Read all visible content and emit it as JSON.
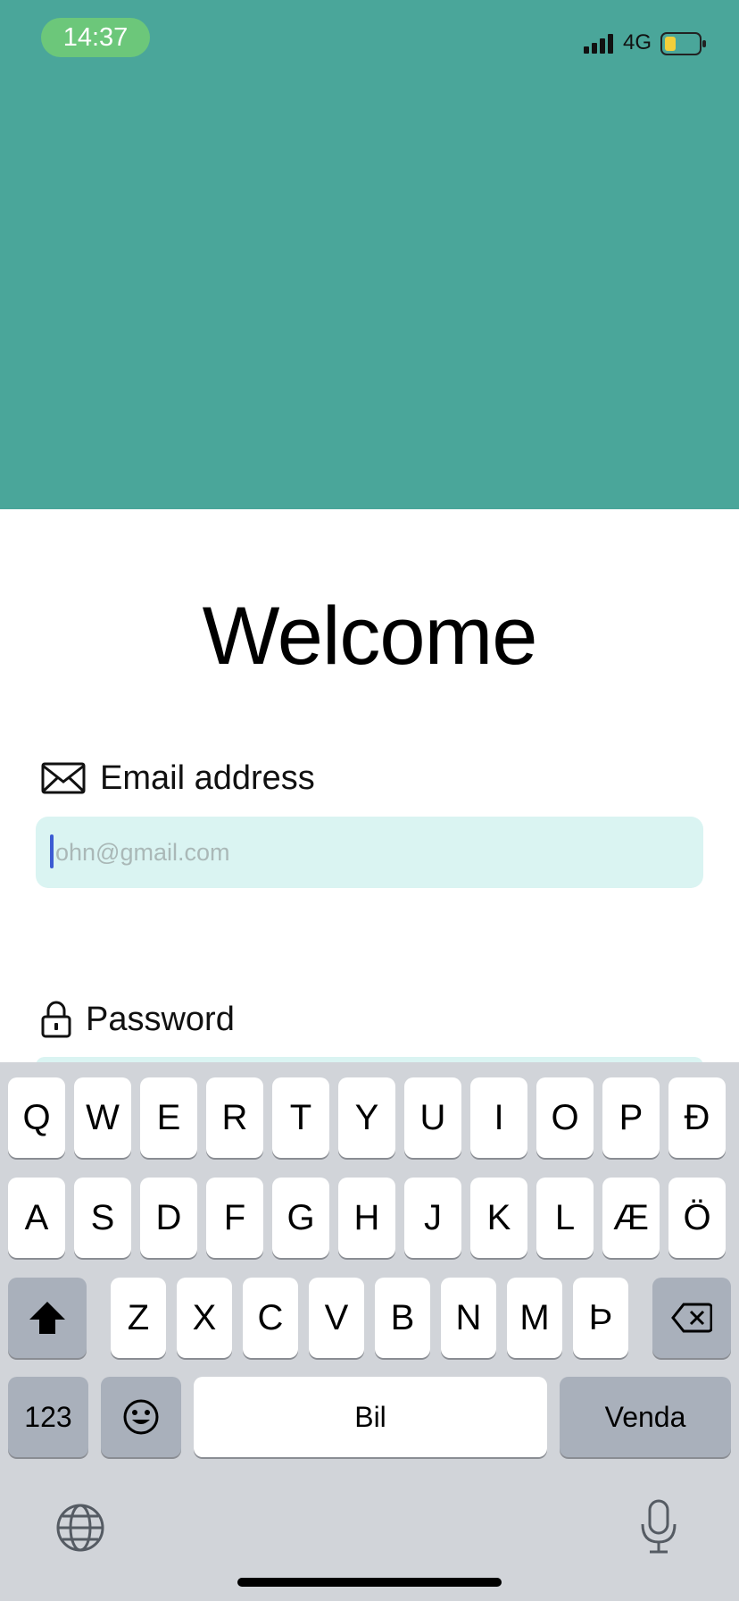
{
  "status_bar": {
    "time": "14:37",
    "network": "4G",
    "battery_color": "#f3cf3b"
  },
  "hero": {
    "color": "#4aa69a"
  },
  "login": {
    "title": "Welcome",
    "email_label": "Email address",
    "email_placeholder": "ohn@gmail.com",
    "password_label": "Password"
  },
  "keyboard": {
    "row1": [
      "Q",
      "W",
      "E",
      "R",
      "T",
      "Y",
      "U",
      "I",
      "O",
      "P",
      "Ð"
    ],
    "row2": [
      "A",
      "S",
      "D",
      "F",
      "G",
      "H",
      "J",
      "K",
      "L",
      "Æ",
      "Ö"
    ],
    "row3": [
      "Z",
      "X",
      "C",
      "V",
      "B",
      "N",
      "M",
      "Þ"
    ],
    "numbers_label": "123",
    "space_label": "Bil",
    "return_label": "Venda",
    "icons": [
      "shift-icon",
      "delete-icon",
      "emoji-icon",
      "globe-icon",
      "microphone-icon"
    ]
  }
}
